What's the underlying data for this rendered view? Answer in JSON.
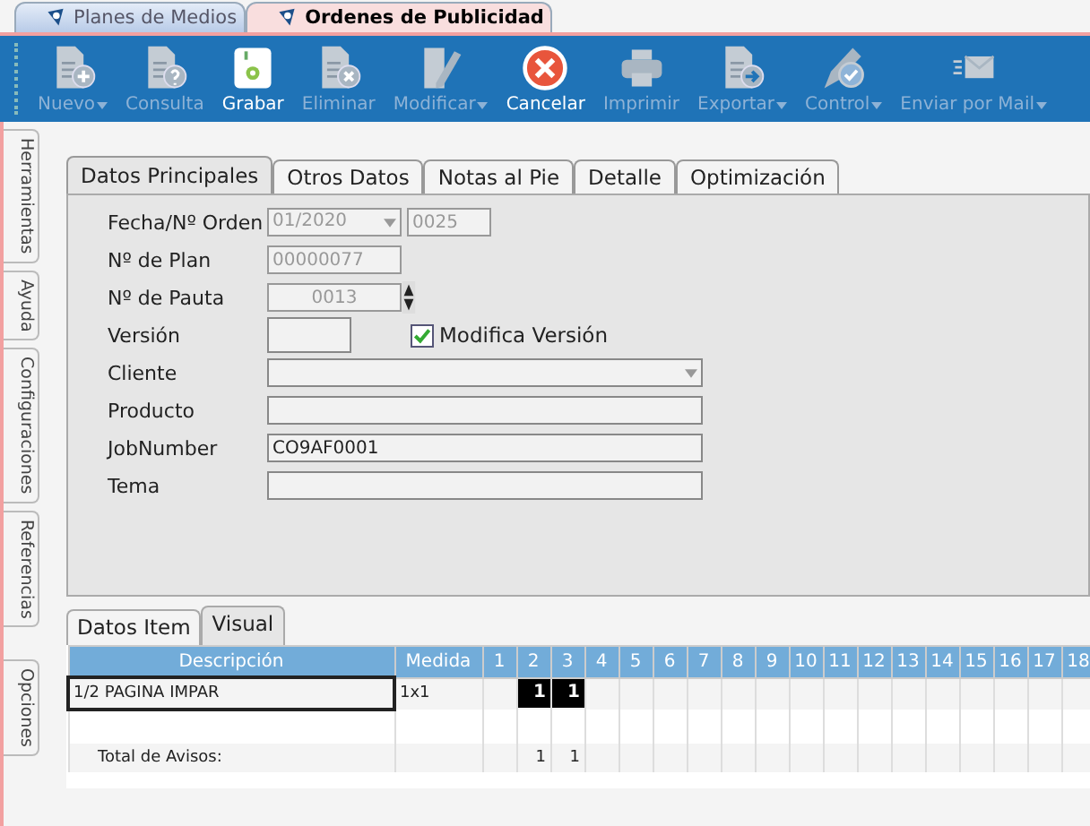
{
  "doc_tabs": [
    {
      "label": "Planes de Medios",
      "selected": false
    },
    {
      "label": "Ordenes de Publicidad",
      "selected": true
    }
  ],
  "toolbar": [
    {
      "label": "Nuevo",
      "disabled": true,
      "dropdown": true
    },
    {
      "label": "Consulta",
      "disabled": true,
      "dropdown": false
    },
    {
      "label": "Grabar",
      "disabled": false,
      "dropdown": false
    },
    {
      "label": "Eliminar",
      "disabled": true,
      "dropdown": false
    },
    {
      "label": "Modificar",
      "disabled": true,
      "dropdown": true
    },
    {
      "label": "Cancelar",
      "disabled": false,
      "dropdown": false
    },
    {
      "label": "Imprimir",
      "disabled": true,
      "dropdown": false
    },
    {
      "label": "Exportar",
      "disabled": true,
      "dropdown": true
    },
    {
      "label": "Control",
      "disabled": true,
      "dropdown": true
    },
    {
      "label": "Enviar por Mail",
      "disabled": true,
      "dropdown": true
    }
  ],
  "side_tabs": [
    "Herramientas",
    "Ayuda",
    "Configuraciones",
    "Referencias",
    "Opciones"
  ],
  "form_tabs": [
    {
      "label": "Datos Principales",
      "selected": true
    },
    {
      "label": "Otros Datos",
      "selected": false
    },
    {
      "label": "Notas al Pie",
      "selected": false
    },
    {
      "label": "Detalle",
      "selected": false
    },
    {
      "label": "Optimización",
      "selected": false
    }
  ],
  "form": {
    "fecha_orden": {
      "label": "Fecha/Nº Orden",
      "date": "01/2020",
      "number": "0025"
    },
    "plan": {
      "label": "Nº de Plan",
      "value": "00000077"
    },
    "pauta": {
      "label": "Nº de Pauta",
      "value": "0013"
    },
    "version": {
      "label": "Versión",
      "checkbox_label": "Modifica Versión",
      "checked": true
    },
    "cliente": {
      "label": "Cliente"
    },
    "producto": {
      "label": "Producto"
    },
    "jobnumber": {
      "label": "JobNumber",
      "value": "CO9AF0001"
    },
    "tema": {
      "label": "Tema"
    }
  },
  "item_tabs": [
    {
      "label": "Datos Item",
      "selected": false
    },
    {
      "label": "Visual",
      "selected": true
    }
  ],
  "grid": {
    "columns": [
      "Descripción",
      "Medida",
      "1",
      "2",
      "3",
      "4",
      "5",
      "6",
      "7",
      "8",
      "9",
      "10",
      "11",
      "12",
      "13",
      "14",
      "15",
      "16",
      "17",
      "18"
    ],
    "rows": [
      {
        "kind": "item",
        "descripcion": "1/2 PAGINA IMPAR",
        "medida": "1x1",
        "days": [
          {
            "kind": "empty"
          },
          {
            "kind": "mark",
            "value": "1",
            "filled": true
          },
          {
            "kind": "mark",
            "value": "1",
            "filled": true
          }
        ]
      },
      {
        "kind": "blank"
      },
      {
        "kind": "total",
        "descripcion": "Total de Avisos:",
        "days": [
          {
            "kind": "empty"
          },
          {
            "kind": "mark",
            "value": "1",
            "filled": false
          },
          {
            "kind": "mark",
            "value": "1",
            "filled": false
          }
        ]
      }
    ]
  }
}
